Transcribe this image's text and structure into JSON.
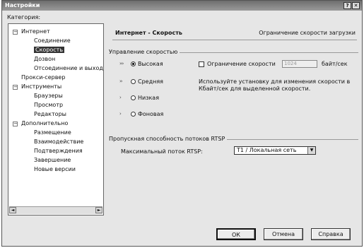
{
  "window": {
    "title": "Настройки",
    "help_btn": "?",
    "close_btn": "✕"
  },
  "category_label": "Категория:",
  "tree": {
    "items": [
      {
        "label": "Интернет",
        "level": 0,
        "expander": "−"
      },
      {
        "label": "Соединение",
        "level": 1
      },
      {
        "label": "Скорость",
        "level": 1,
        "selected": true
      },
      {
        "label": "Дозвон",
        "level": 1
      },
      {
        "label": "Отсоединение и выход",
        "level": 1
      },
      {
        "label": "Прокси-сервер",
        "level": 0
      },
      {
        "label": "Инструменты",
        "level": 0,
        "expander": "−"
      },
      {
        "label": "Браузеры",
        "level": 1
      },
      {
        "label": "Просмотр",
        "level": 1
      },
      {
        "label": "Редакторы",
        "level": 1
      },
      {
        "label": "Дополнительно",
        "level": 0,
        "expander": "−"
      },
      {
        "label": "Размещение",
        "level": 1
      },
      {
        "label": "Взаимодействие",
        "level": 1
      },
      {
        "label": "Подтверждения",
        "level": 1
      },
      {
        "label": "Завершение",
        "level": 1
      },
      {
        "label": "Новые версии",
        "level": 1
      }
    ],
    "scroll_left": "◄",
    "scroll_right": "►"
  },
  "panel": {
    "title": "Интернет - Скорость",
    "description": "Ограничение скорости загрузки"
  },
  "speed_group": {
    "label": "Управление скоростью",
    "options": [
      {
        "label": "Высокая",
        "selected": true
      },
      {
        "label": "Средняя",
        "selected": false
      },
      {
        "label": "Низкая",
        "selected": false
      },
      {
        "label": "Фоновая",
        "selected": false
      }
    ],
    "limit_checkbox_label": "Ограничение скорости",
    "limit_value": "1024",
    "limit_unit": "байт/сек",
    "hint_line1": "Используйте установку для изменения скорости в",
    "hint_line2": "Кбайт/сек для выделенной скорости."
  },
  "rtsp_group": {
    "label": "Пропускная способность потоков RTSP",
    "max_stream_label": "Максимальный поток RTSP:",
    "max_stream_value": "T1 / Локальная сеть"
  },
  "buttons": {
    "ok": "ОК",
    "cancel": "Отмена",
    "help": "Справка"
  }
}
